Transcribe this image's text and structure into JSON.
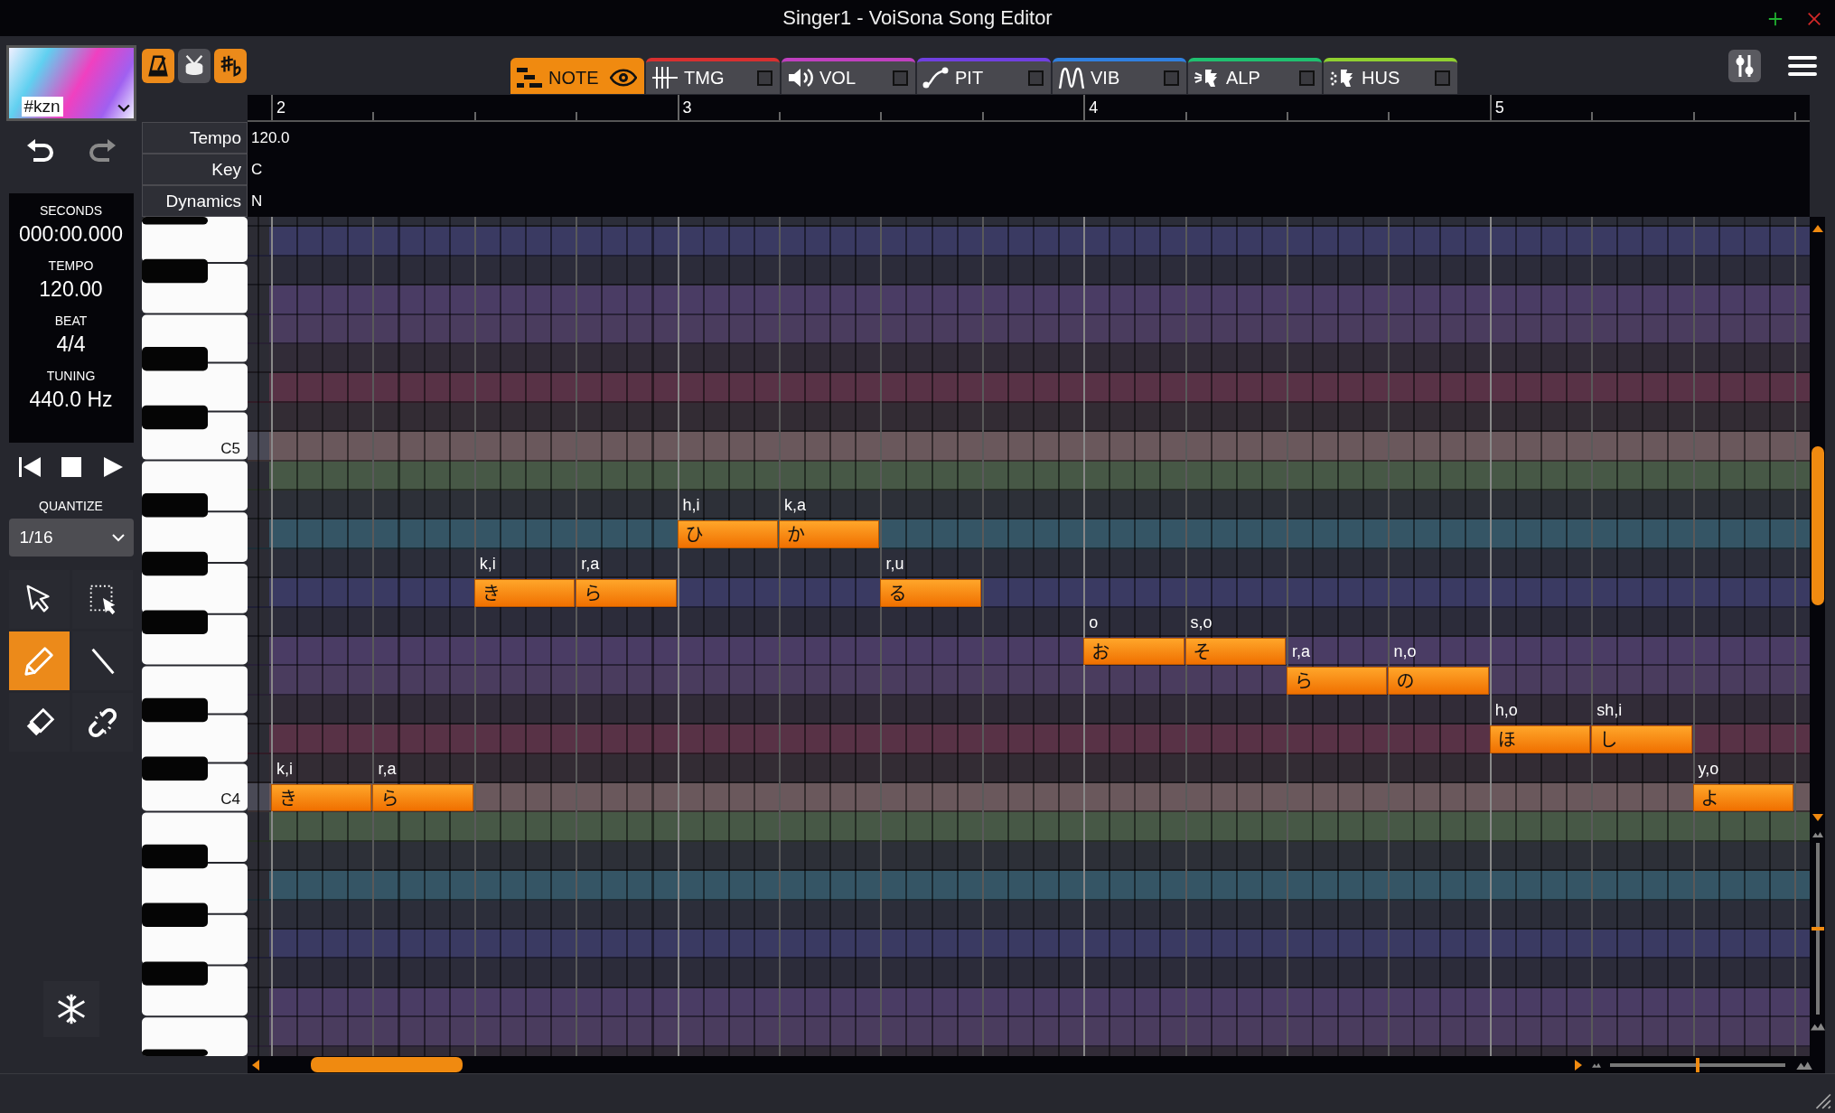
{
  "window": {
    "title": "Singer1 - VoiSona Song Editor"
  },
  "singer": {
    "name": "#kzn"
  },
  "toggles": [
    {
      "on": true
    },
    {
      "on": false
    },
    {
      "on": true
    }
  ],
  "tabs": [
    {
      "label": "NOTE",
      "kind": "eye",
      "selected": true,
      "color": "#f08a10"
    },
    {
      "label": "TMG",
      "kind": "checkbox",
      "selected": false,
      "checked": false,
      "color": "#d83030"
    },
    {
      "label": "VOL",
      "kind": "checkbox",
      "selected": false,
      "checked": false,
      "color": "#c040c0"
    },
    {
      "label": "PIT",
      "kind": "checkbox",
      "selected": false,
      "checked": false,
      "color": "#7040e0"
    },
    {
      "label": "VIB",
      "kind": "checkbox",
      "selected": false,
      "checked": false,
      "color": "#3080e0"
    },
    {
      "label": "ALP",
      "kind": "checkbox",
      "selected": false,
      "checked": false,
      "color": "#20c070"
    },
    {
      "label": "HUS",
      "kind": "checkbox",
      "selected": false,
      "checked": false,
      "color": "#90d030"
    }
  ],
  "history": [
    {
      "kind": "undo",
      "disabled": false
    },
    {
      "kind": "redo",
      "disabled": true
    }
  ],
  "info": [
    {
      "label": "SECONDS",
      "value": "000:00.000"
    },
    {
      "label": "TEMPO",
      "value": "120.00"
    },
    {
      "label": "BEAT",
      "value": "4/4"
    },
    {
      "label": "TUNING",
      "value": "440.0 Hz"
    }
  ],
  "quantize": {
    "label": "QUANTIZE",
    "value": "1/16"
  },
  "tools": [
    {
      "selected": false
    },
    {
      "selected": false
    },
    {
      "selected": true
    },
    {
      "selected": false
    },
    {
      "selected": false
    },
    {
      "selected": false
    }
  ],
  "ruler": {
    "measures": [
      "2",
      "3",
      "4",
      "5"
    ]
  },
  "parameters": [
    {
      "label": "Tempo",
      "value": "120.0"
    },
    {
      "label": "Key",
      "value": "C"
    },
    {
      "label": "Dynamics",
      "value": "N"
    }
  ],
  "keyboard": {
    "labels": [
      "C5",
      "C4"
    ]
  },
  "notes": [
    {
      "phoneme": "k,i",
      "lyric": "き"
    },
    {
      "phoneme": "r,a",
      "lyric": "ら"
    },
    {
      "phoneme": "k,i",
      "lyric": "き"
    },
    {
      "phoneme": "r,a",
      "lyric": "ら"
    },
    {
      "phoneme": "h,i",
      "lyric": "ひ"
    },
    {
      "phoneme": "k,a",
      "lyric": "か"
    },
    {
      "phoneme": "r,u",
      "lyric": "る"
    },
    {
      "phoneme": "o",
      "lyric": "お"
    },
    {
      "phoneme": "s,o",
      "lyric": "そ"
    },
    {
      "phoneme": "r,a",
      "lyric": "ら"
    },
    {
      "phoneme": "n,o",
      "lyric": "の"
    },
    {
      "phoneme": "h,o",
      "lyric": "ほ"
    },
    {
      "phoneme": "sh,i",
      "lyric": "し"
    },
    {
      "phoneme": "y,o",
      "lyric": "よ"
    }
  ],
  "zoom": {
    "horizontal": {
      "level": 0.5
    },
    "vertical": {
      "level": 0.5
    }
  }
}
